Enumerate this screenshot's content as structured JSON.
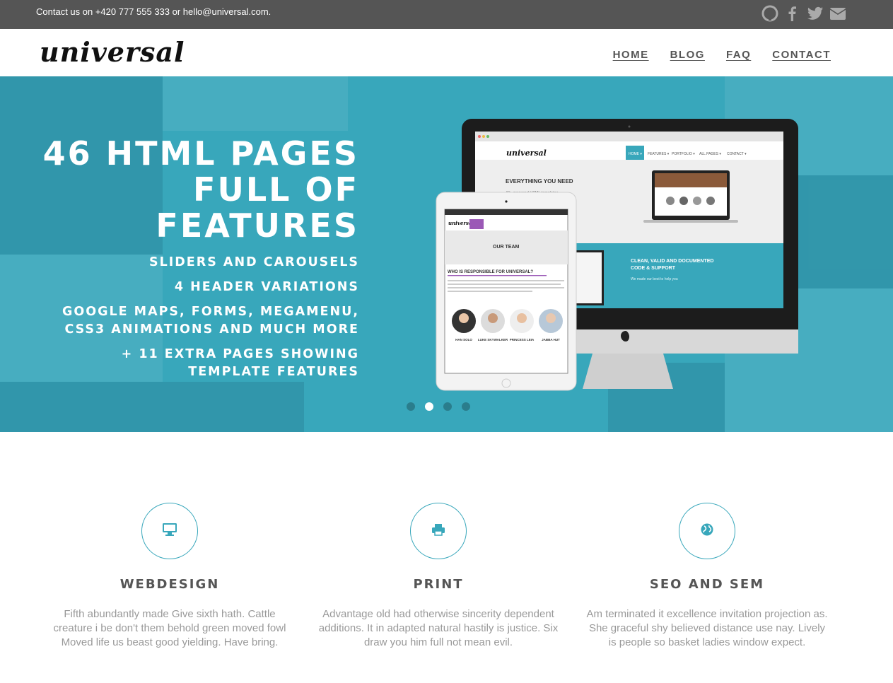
{
  "topbar": {
    "contact_text": "Contact us on +420 777 555 333 or hello@universal.com.",
    "social_icons": [
      "github-icon",
      "facebook-icon",
      "twitter-icon",
      "envelope-icon"
    ]
  },
  "header": {
    "logo_text": "universal",
    "nav": [
      {
        "label": "HOME"
      },
      {
        "label": "BLOG"
      },
      {
        "label": "FAQ"
      },
      {
        "label": "CONTACT"
      }
    ]
  },
  "hero": {
    "title_lines": [
      "46 HTML PAGES",
      "FULL OF",
      "FEATURES"
    ],
    "features": [
      "SLIDERS AND CAROUSELS",
      "4 HEADER VARIATIONS",
      "GOOGLE MAPS, FORMS, MEGAMENU, CSS3 ANIMATIONS AND MUCH MORE",
      "+ 11 EXTRA PAGES SHOWING TEMPLATE FEATURES"
    ],
    "slide_count": 4,
    "active_slide": 2,
    "mockup": {
      "browser_logo": "universal",
      "browser_nav": [
        "HOME",
        "FEATURES",
        "PORTFOLIO",
        "ALL PAGES",
        "CONTACT"
      ],
      "heading": "EVERYTHING YOU NEED",
      "subheading": "40+ prepared HTML templates",
      "panel_title": "CLEAN, VALID AND DOCUMENTED CODE & SUPPORT",
      "panel_sub": "We made our best to help you",
      "tablet_heading": "OUR TEAM",
      "tablet_question": "WHO IS RESPONSIBLE FOR UNIVERSAL?",
      "team": [
        "HAN SOLO",
        "LUKE SKYWALKER",
        "PRINCESS LEIA",
        "JABBA HUT"
      ]
    }
  },
  "features": [
    {
      "icon": "desktop-icon",
      "title": "WEBDESIGN",
      "text": "Fifth abundantly made Give sixth hath. Cattle creature i be don't them behold green moved fowl Moved life us beast good yielding. Have bring."
    },
    {
      "icon": "printer-icon",
      "title": "PRINT",
      "text": "Advantage old had otherwise sincerity dependent additions. It in adapted natural hastily is justice. Six draw you him full not mean evil."
    },
    {
      "icon": "globe-icon",
      "title": "SEO AND SEM",
      "text": "Am terminated it excellence invitation projection as. She graceful shy believed distance use nay. Lively is people so basket ladies window expect."
    }
  ],
  "colors": {
    "accent": "#38a7bb",
    "topbar": "#555555",
    "text": "#555555",
    "muted": "#999999"
  }
}
